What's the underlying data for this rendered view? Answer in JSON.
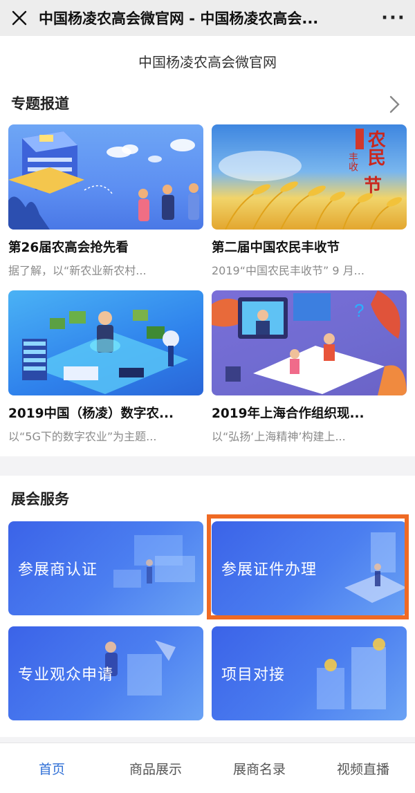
{
  "topbar": {
    "title": "中国杨凌农高会微官网 - 中国杨凌农高会...",
    "more_label": "···"
  },
  "page": {
    "subtitle": "中国杨凌农高会微官网"
  },
  "topics": {
    "title": "专题报道",
    "cards": [
      {
        "title": "第26届农高会抢先看",
        "desc": "据了解，以“新农业新农村..."
      },
      {
        "title": "第二届中国农民丰收节",
        "desc": "2019“中国农民丰收节” 9 月..."
      },
      {
        "title": "2019中国（杨凌）数字农...",
        "desc": "以“5G下的数字农业”为主题..."
      },
      {
        "title": "2019年上海合作组织现...",
        "desc": "以“弘扬‘上海精神’构建上..."
      }
    ],
    "harvest_art": {
      "big": "农民",
      "small1": "丰收",
      "small2": "节"
    }
  },
  "services": {
    "title": "展会服务",
    "items": [
      {
        "label": "参展商认证"
      },
      {
        "label": "参展证件办理"
      },
      {
        "label": "专业观众申请"
      },
      {
        "label": "项目对接"
      }
    ]
  },
  "bottom_nav": {
    "items": [
      {
        "label": "首页",
        "active": true
      },
      {
        "label": "商品展示"
      },
      {
        "label": "展商名录"
      },
      {
        "label": "视频直播"
      }
    ]
  },
  "colors": {
    "accent": "#2f6fd6",
    "highlight_border": "#ef6a24",
    "service_tile": "#4b7ef0"
  }
}
